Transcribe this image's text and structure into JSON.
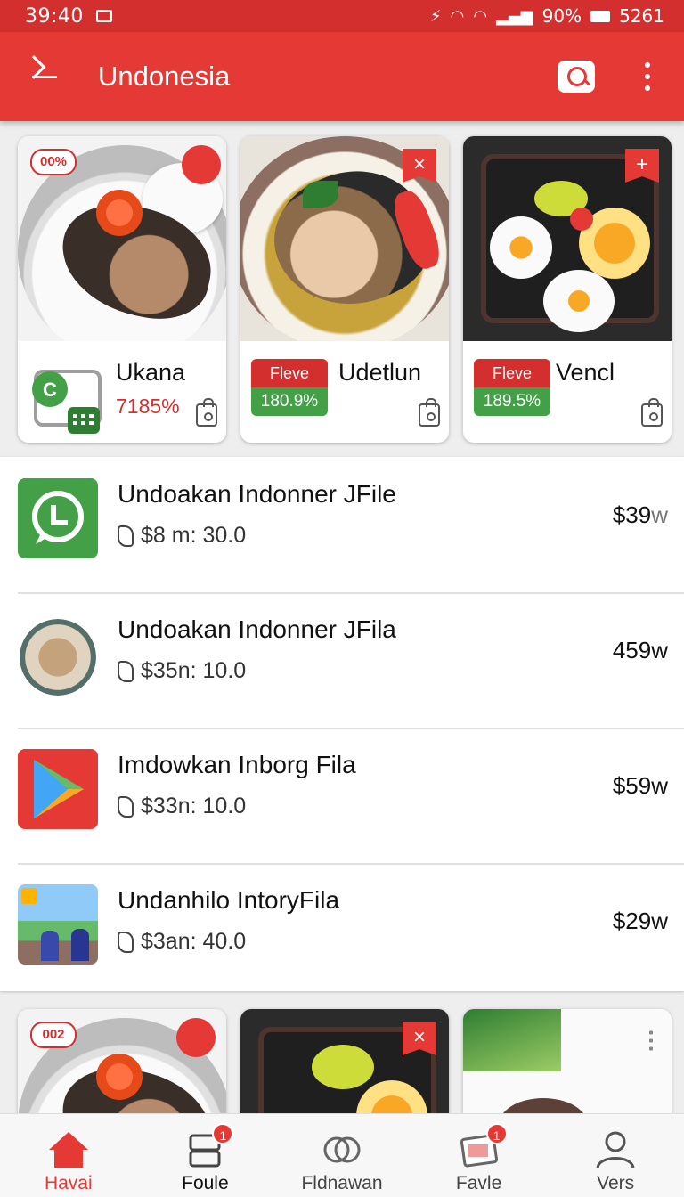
{
  "status_bar": {
    "time": "39:40",
    "battery": "90%",
    "clock_right": "5261"
  },
  "app_bar": {
    "title": "Undonesia"
  },
  "top_cards": [
    {
      "badge": "00%",
      "name": "Ukana",
      "percent": "7185%"
    },
    {
      "tag_top": "Fleve",
      "tag_bottom": "180.9%",
      "name": "Udetlun"
    },
    {
      "tag_top": "Fleve",
      "tag_bottom": "189.5%",
      "name": "Vencl"
    }
  ],
  "list_items": [
    {
      "name": "Undoakan Indonner JFile",
      "sub": "$8 m: 30.0",
      "price_main": "$39",
      "price_unit": "w",
      "icon": "chat-app-icon"
    },
    {
      "name": "Undoakan Indonner JFila",
      "sub": "$35n: 10.0",
      "price_main": "459",
      "price_unit": "w",
      "icon": "food-plate-icon"
    },
    {
      "name": "Imdowkan Inborg Fila",
      "sub": "$33n: 10.0",
      "price_main": "$59",
      "price_unit": "w",
      "icon": "play-store-icon"
    },
    {
      "name": "Undanhilo IntoryFila",
      "sub": "$3an: 40.0",
      "price_main": "$29",
      "price_unit": "w",
      "icon": "photo-thumbnail-icon"
    }
  ],
  "bottom_cards": [
    {
      "badge": "002"
    },
    {},
    {}
  ],
  "bottom_nav": [
    {
      "label": "Havai",
      "icon": "home-icon",
      "active": true
    },
    {
      "label": "Foule",
      "icon": "layers-icon",
      "badge": "1"
    },
    {
      "label": "Fldnawan",
      "icon": "rings-icon"
    },
    {
      "label": "Favle",
      "icon": "image-card-icon",
      "badge": "1"
    },
    {
      "label": "Vers",
      "icon": "person-icon"
    }
  ],
  "colors": {
    "primary": "#e53935",
    "status_bar": "#d32f2f",
    "green": "#43a047"
  }
}
